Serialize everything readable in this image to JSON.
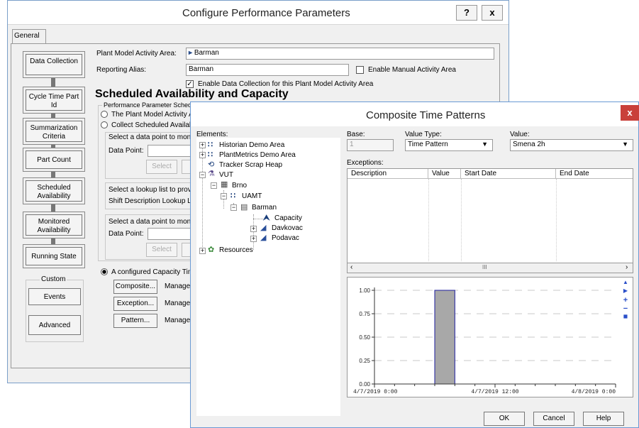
{
  "back": {
    "title": "Configure Performance Parameters",
    "help_btn": "?",
    "close_btn": "x",
    "tab": "General",
    "nav": [
      {
        "label": "Data Collection"
      },
      {
        "label": "Cycle Time Part Id"
      },
      {
        "label": "Summarization Criteria"
      },
      {
        "label": "Part Count"
      },
      {
        "label": "Scheduled Availability"
      },
      {
        "label": "Monitored Availability"
      },
      {
        "label": "Running State"
      }
    ],
    "custom_label": "Custom",
    "events": "Events",
    "advanced": "Advanced",
    "plant_area_label": "Plant Model Activity Area:",
    "plant_area_value": "Barman",
    "reporting_alias_label": "Reporting Alias:",
    "reporting_alias_value": "Barman",
    "enable_manual": "Enable Manual Activity Area",
    "enable_collection": "Enable Data Collection for this Plant Model Activity Area",
    "section_heading": "Scheduled Availability and Capacity",
    "group_label": "Performance Parameter Scheduled Availability and Capacity",
    "radio1": "The Plant Model Activity A",
    "radio2": "Collect Scheduled Availab",
    "select_dp1": "Select a data point to moni",
    "data_point1": "Data Point:",
    "select_btn1": "Select",
    "select_lookup": "Select a lookup list to provi",
    "shift_desc": "Shift Description Lookup L",
    "select_dp2": "Select a data point to moni",
    "data_point2": "Data Point:",
    "select_btn2": "Select",
    "configured_cap": "A configured Capacity Tim",
    "composite_btn": "Composite...",
    "composite_manage": "Manage",
    "exception_btn": "Exception...",
    "exception_manage": "Manage",
    "pattern_btn": "Pattern...",
    "pattern_manage": "Manage"
  },
  "front": {
    "title": "Composite Time Patterns",
    "close": "x",
    "elements_label": "Elements:",
    "tree": [
      {
        "label": "Historian Demo Area"
      },
      {
        "label": "PlantMetrics Demo Area"
      },
      {
        "label": "Tracker Scrap Heap"
      },
      {
        "label": "VUT"
      },
      {
        "label": "Brno"
      },
      {
        "label": "UAMT"
      },
      {
        "label": "Barman"
      },
      {
        "label": "Capacity"
      },
      {
        "label": "Davkovac"
      },
      {
        "label": "Podavac"
      },
      {
        "label": "Resources"
      }
    ],
    "base_label": "Base:",
    "base_value": "1",
    "value_type_label": "Value Type:",
    "value_type_value": "Time Pattern",
    "value_label": "Value:",
    "value_value": "Smena 2h",
    "exceptions_label": "Exceptions:",
    "columns": [
      "Description",
      "Value",
      "Start Date",
      "End Date"
    ],
    "scroll_thumb": "III",
    "ok": "OK",
    "cancel": "Cancel",
    "help": "Help"
  },
  "chart_data": {
    "type": "bar",
    "x_ticks": [
      "4/7/2019 0:00",
      "4/7/2019 12:00",
      "4/8/2019 0:00"
    ],
    "y_ticks": [
      "0.00",
      "0.25",
      "0.50",
      "0.75",
      "1.00"
    ],
    "ylim": [
      0,
      1
    ],
    "xlim_hours": [
      0,
      24
    ],
    "bars": [
      {
        "start_hour": 6,
        "end_hour": 8,
        "value": 1.0
      }
    ],
    "bar_color": "#a8a8a8",
    "grid": true
  }
}
